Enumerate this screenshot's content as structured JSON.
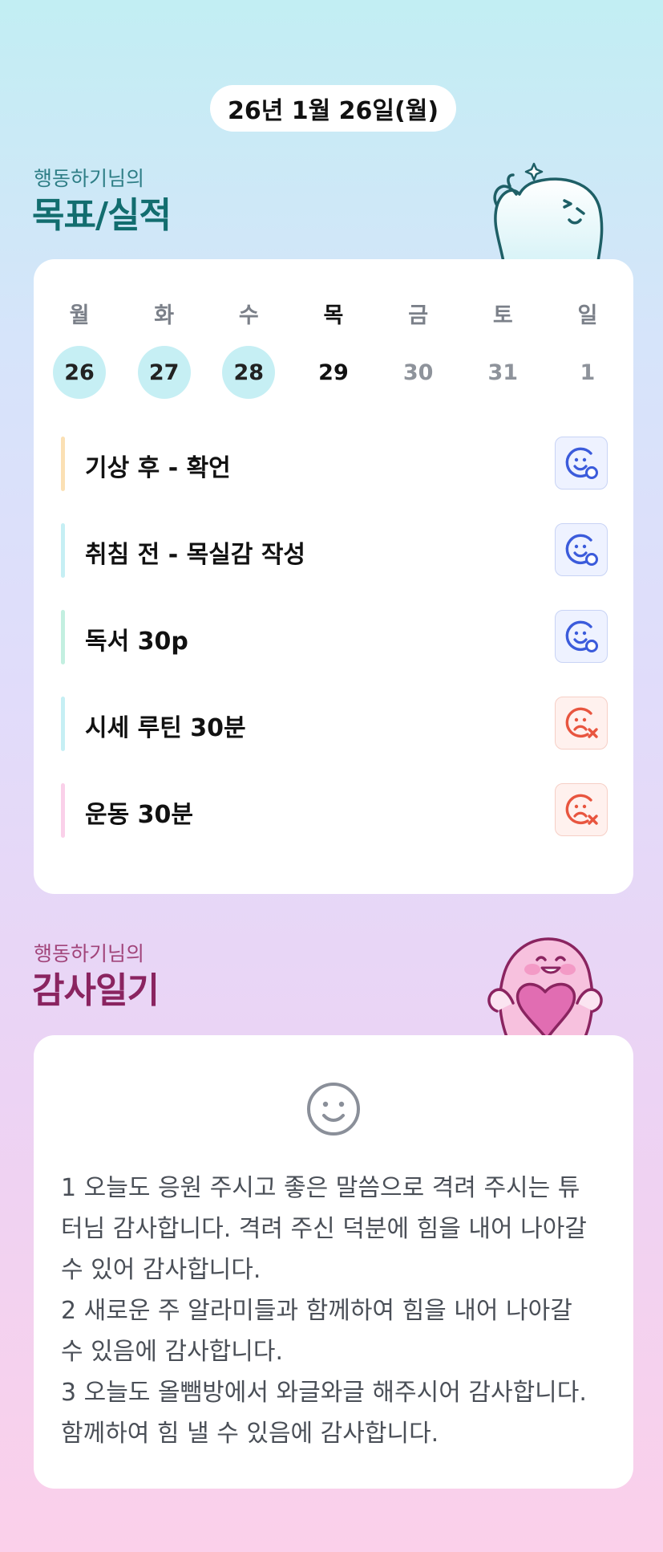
{
  "header": {
    "date": "26년 1월 26일(월)"
  },
  "goals_section": {
    "subtitle": "행동하기님의",
    "title": "목표/실적"
  },
  "week": {
    "weekdays": [
      "월",
      "화",
      "수",
      "목",
      "금",
      "토",
      "일"
    ],
    "dates": [
      "26",
      "27",
      "28",
      "29",
      "30",
      "31",
      "1"
    ],
    "states": [
      "done",
      "done",
      "done",
      "today",
      "future",
      "future",
      "future"
    ]
  },
  "goals": [
    {
      "label": "기상 후 - 확언",
      "bar_color": "#fbe0b4",
      "status": "success",
      "status_icon": "smile-check-icon"
    },
    {
      "label": "취침 전 - 목실감 작성",
      "bar_color": "#c6eff4",
      "status": "success",
      "status_icon": "smile-check-icon"
    },
    {
      "label": "독서 30p",
      "bar_color": "#c3efe0",
      "status": "success",
      "status_icon": "smile-check-icon"
    },
    {
      "label": "시세 루틴 30분",
      "bar_color": "#c6eff4",
      "status": "fail",
      "status_icon": "sad-x-icon"
    },
    {
      "label": "운동 30분",
      "bar_color": "#fad0e9",
      "status": "fail",
      "status_icon": "sad-x-icon"
    }
  ],
  "colors": {
    "success_icon": "#3b5bdb",
    "fail_icon": "#e8553f"
  },
  "gratitude_section": {
    "subtitle": "행동하기님의",
    "title": "감사일기",
    "lines": [
      "1 오늘도 응원 주시고 좋은 말씀으로 격려 주시는 튜",
      "터님 감사합니다. 격려 주신 덕분에 힘을 내어 나아갈",
      "수 있어 감사합니다.",
      "2 새로운 주 알라미들과 함께하여 힘을 내어 나아갈",
      "수 있음에 감사합니다.",
      "3 오늘도 올뺌방에서 와글와글 해주시어 감사합니다.",
      "함께하여 힘 낼 수 있음에 감사합니다."
    ]
  }
}
